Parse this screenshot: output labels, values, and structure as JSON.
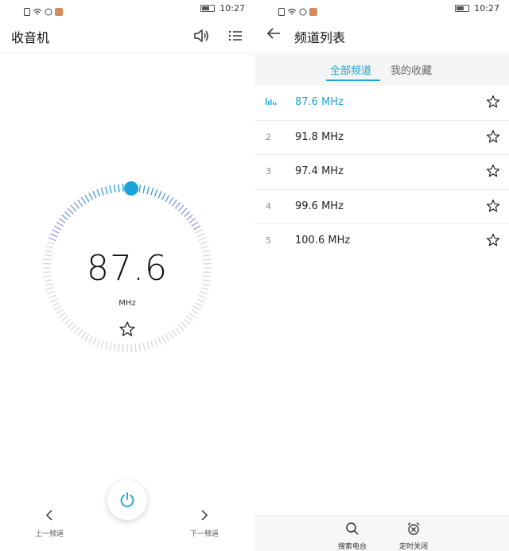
{
  "status": {
    "time": "10:27"
  },
  "radio": {
    "title": "收音机",
    "frequency": "87.6",
    "unit": "MHz",
    "dial_level": 0.0,
    "prev_label": "上一频道",
    "next_label": "下一频道"
  },
  "list": {
    "title": "频道列表",
    "tabs": [
      {
        "label": "全部频道",
        "active": true
      },
      {
        "label": "我的收藏",
        "active": false
      }
    ],
    "channels": [
      {
        "index": "",
        "frequency": "87.6 MHz",
        "playing": true
      },
      {
        "index": "2",
        "frequency": "91.8 MHz",
        "playing": false
      },
      {
        "index": "3",
        "frequency": "97.4 MHz",
        "playing": false
      },
      {
        "index": "4",
        "frequency": "99.6 MHz",
        "playing": false
      },
      {
        "index": "5",
        "frequency": "100.6 MHz",
        "playing": false
      }
    ],
    "search_label": "搜索电台",
    "timer_label": "定时关闭"
  },
  "colors": {
    "accent": "#1aa3d6",
    "tick": "#d9d9d9",
    "gradient_end": "#b59be3"
  }
}
